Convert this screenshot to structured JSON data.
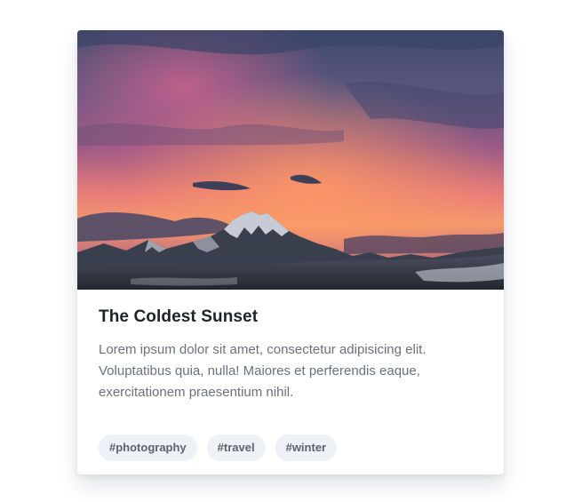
{
  "card": {
    "image_alt": "Mountain peak under a vivid pink and orange sunset sky",
    "title": "The Coldest Sunset",
    "description": "Lorem ipsum dolor sit amet, consectetur adipisicing elit. Voluptatibus quia, nulla! Maiores et perferendis eaque, exercitationem praesentium nihil.",
    "tags": [
      "#photography",
      "#travel",
      "#winter"
    ]
  },
  "colors": {
    "sky_top": "#3d4a6e",
    "sunset_pink": "#e46b86",
    "sunset_orange": "#f48a5e",
    "mountain": "#3b4150",
    "snow": "#dfe4ee",
    "tag_bg": "#eef1f5",
    "title": "#1f2328",
    "text": "#6a717c"
  }
}
